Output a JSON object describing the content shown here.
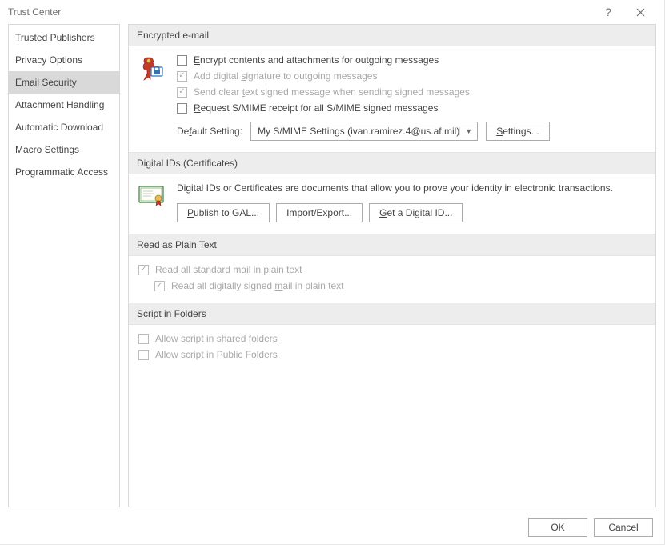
{
  "window": {
    "title": "Trust Center",
    "help": "?",
    "close": "×"
  },
  "sidebar": {
    "items": [
      {
        "label": "Trusted Publishers",
        "selected": false
      },
      {
        "label": "Privacy Options",
        "selected": false
      },
      {
        "label": "Email Security",
        "selected": true
      },
      {
        "label": "Attachment Handling",
        "selected": false
      },
      {
        "label": "Automatic Download",
        "selected": false
      },
      {
        "label": "Macro Settings",
        "selected": false
      },
      {
        "label": "Programmatic Access",
        "selected": false
      }
    ]
  },
  "sections": {
    "encrypted": {
      "header": "Encrypted e-mail",
      "opt_encrypt": "ncrypt contents and attachments for outgoing messages",
      "opt_encrypt_u": "E",
      "opt_addsig": "Add digital ",
      "opt_addsig_u": "s",
      "opt_addsig_tail": "ignature to outgoing messages",
      "opt_cleartext_pre": "Send clear ",
      "opt_cleartext_u": "t",
      "opt_cleartext_tail": "ext signed message when sending signed messages",
      "opt_receipt_u": "R",
      "opt_receipt": "equest S/MIME receipt for all S/MIME signed messages",
      "default_label_pre": "De",
      "default_label_u": "f",
      "default_label_tail": "ault Setting:",
      "dropdown_value": "My S/MIME Settings (ivan.ramirez.4@us.af.mil)",
      "settings_btn_u": "S",
      "settings_btn_tail": "ettings..."
    },
    "digital_ids": {
      "header": "Digital IDs (Certificates)",
      "desc": "Digital IDs or Certificates are documents that allow you to prove your identity in electronic transactions.",
      "btn_publish_u": "P",
      "btn_publish": "ublish to GAL...",
      "btn_import": "Import/Export...",
      "btn_getid_u": "G",
      "btn_getid": "et a Digital ID..."
    },
    "plaintext": {
      "header": "Read as Plain Text",
      "opt_readplain": "Read all standard mail in plain text",
      "opt_readsigned_pre": "Read all digitally signed ",
      "opt_readsigned_u": "m",
      "opt_readsigned_tail": "ail in plain text"
    },
    "script": {
      "header": "Script in Folders",
      "opt_shared_pre": "Allow script in shared ",
      "opt_shared_u": "f",
      "opt_shared_tail": "olders",
      "opt_public_pre": "Allow script in Public F",
      "opt_public_u": "o",
      "opt_public_tail": "lders"
    }
  },
  "footer": {
    "ok": "OK",
    "cancel": "Cancel"
  }
}
